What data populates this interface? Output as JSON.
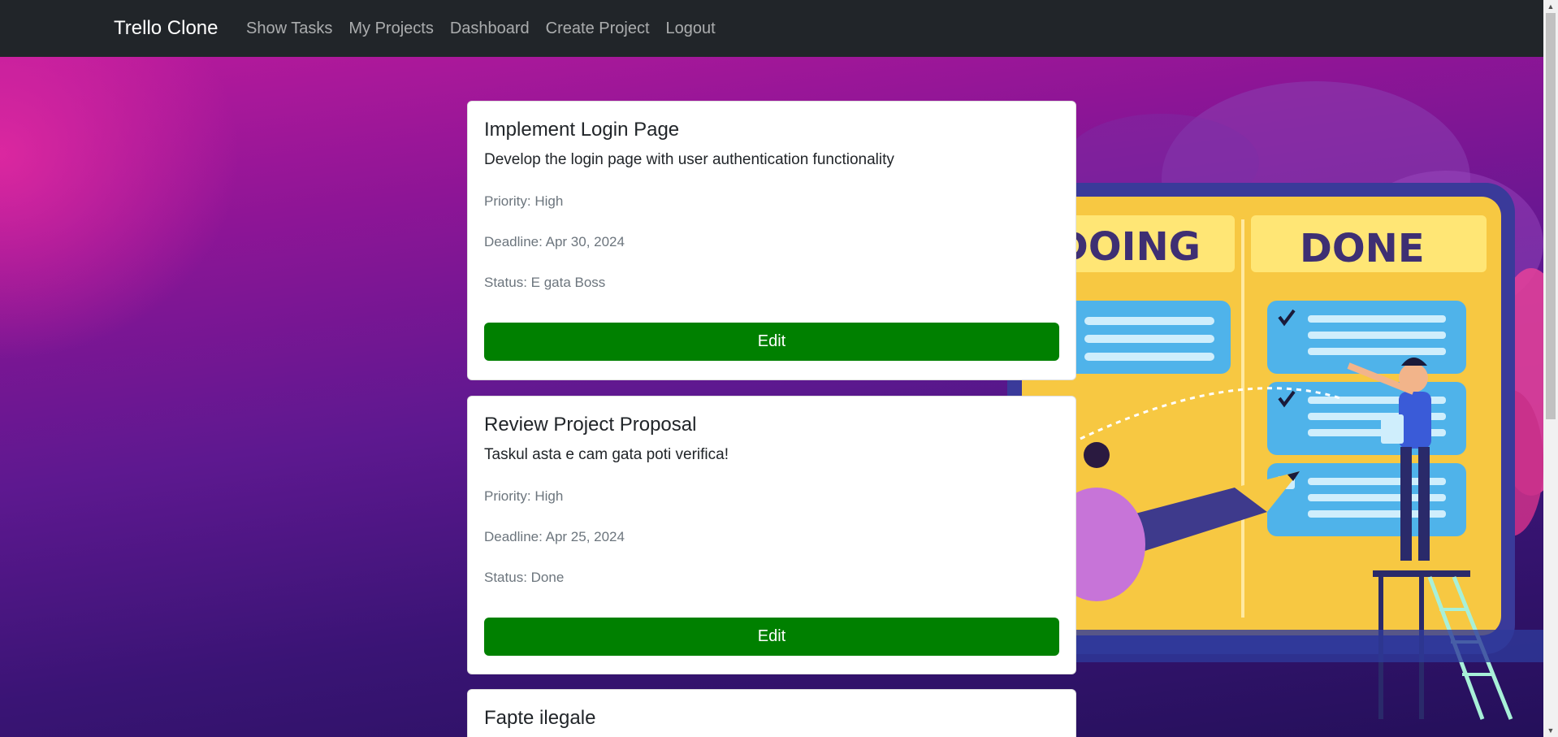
{
  "navbar": {
    "brand": "Trello Clone",
    "links": [
      {
        "label": "Show Tasks"
      },
      {
        "label": "My Projects"
      },
      {
        "label": "Dashboard"
      },
      {
        "label": "Create Project"
      },
      {
        "label": "Logout"
      }
    ]
  },
  "background": {
    "doing_label": "DOING",
    "done_label": "DONE"
  },
  "tasks": [
    {
      "title": "Implement Login Page",
      "description": "Develop the login page with user authentication functionality",
      "priority": "Priority: High",
      "deadline": "Deadline: Apr 30, 2024",
      "status": "Status: E gata Boss",
      "edit_label": "Edit"
    },
    {
      "title": "Review Project Proposal",
      "description": "Taskul asta e cam gata poti verifica!",
      "priority": "Priority: High",
      "deadline": "Deadline: Apr 25, 2024",
      "status": "Status: Done",
      "edit_label": "Edit"
    },
    {
      "title": "Fapte ilegale"
    }
  ],
  "colors": {
    "navbar": "#212529",
    "edit_button": "#008000",
    "background_pink": "#d62aa0",
    "background_purple": "#2a1260"
  },
  "icons": {
    "scroll_up": "scroll-up-arrow-icon",
    "scroll_down": "scroll-down-arrow-icon"
  }
}
